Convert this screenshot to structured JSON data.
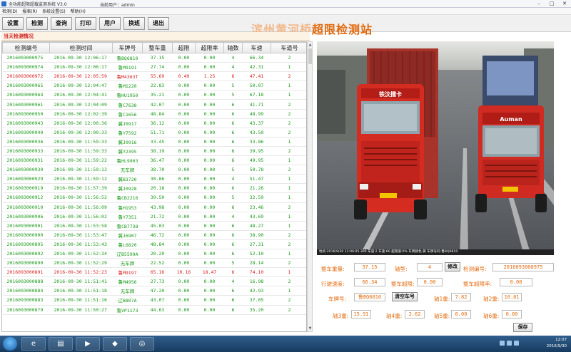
{
  "window": {
    "title": "全功能超限超载监测系统 V3.0",
    "user": "当前用户：admin"
  },
  "menu": [
    "检测(D)",
    "报表(R)",
    "系统设置(S)",
    "帮助(H)"
  ],
  "toolbar": {
    "buttons": [
      "设置",
      "检测",
      "查询",
      "打印",
      "用户",
      "换班",
      "退出"
    ]
  },
  "station": {
    "name_prefix": "滨州黄河桥",
    "name": "超限检测站"
  },
  "section": {
    "label": "当天检测情况"
  },
  "table": {
    "headers": [
      "检测编号",
      "检测时间",
      "车牌号",
      "整车重",
      "超限",
      "超限率",
      "轴数",
      "车速",
      "车道号"
    ],
    "rows": [
      {
        "id": "2016093000975",
        "time": "2016-09-30 12:06:17",
        "plate": "鲁BQ6810",
        "weight": "37.15",
        "over": "0.00",
        "rate": "0.00",
        "axles": "4",
        "speed": "66.34",
        "lane": "2",
        "status": "normal"
      },
      {
        "id": "2016093000974",
        "time": "2016-09-30 12:06:17",
        "plate": "鲁M9191",
        "weight": "27.74",
        "over": "0.00",
        "rate": "0.00",
        "axles": "4",
        "speed": "42.31",
        "lane": "1",
        "status": "normal"
      },
      {
        "id": "2016093000972",
        "time": "2016-09-30 12:05:59",
        "plate": "鲁M4363T",
        "weight": "55.69",
        "over": "0.49",
        "rate": "1.25",
        "axles": "6",
        "speed": "47.41",
        "lane": "2",
        "status": "over"
      },
      {
        "id": "2016093000965",
        "time": "2016-09-30 12:04:47",
        "plate": "鲁M1220",
        "weight": "22.83",
        "over": "0.00",
        "rate": "0.00",
        "axles": "5",
        "speed": "50.07",
        "lane": "1",
        "status": "normal"
      },
      {
        "id": "2016093000964",
        "time": "2016-09-30 12:04:41",
        "plate": "鲁HU1950",
        "weight": "35.21",
        "over": "0.00",
        "rate": "0.00",
        "axles": "5",
        "speed": "67.18",
        "lane": "1",
        "status": "normal"
      },
      {
        "id": "2016093000961",
        "time": "2016-09-30 12:04:09",
        "plate": "鲁C7638",
        "weight": "42.07",
        "over": "0.00",
        "rate": "0.00",
        "axles": "6",
        "speed": "41.71",
        "lane": "2",
        "status": "normal"
      },
      {
        "id": "2016093000950",
        "time": "2016-09-30 12:02:39",
        "plate": "鲁C1656",
        "weight": "48.84",
        "over": "0.00",
        "rate": "0.00",
        "axles": "6",
        "speed": "48.99",
        "lane": "2",
        "status": "normal"
      },
      {
        "id": "2016093000943",
        "time": "2016-09-30 12:00:36",
        "plate": "冀J0917",
        "weight": "36.12",
        "over": "0.00",
        "rate": "0.00",
        "axles": "6",
        "speed": "43.37",
        "lane": "2",
        "status": "normal"
      },
      {
        "id": "2016093000940",
        "time": "2016-09-30 12:00:33",
        "plate": "鲁Y7592",
        "weight": "51.71",
        "over": "0.00",
        "rate": "0.00",
        "axles": "6",
        "speed": "43.50",
        "lane": "2",
        "status": "normal"
      },
      {
        "id": "2016093000936",
        "time": "2016-09-30 11:59:33",
        "plate": "冀J0916",
        "weight": "33.45",
        "over": "0.00",
        "rate": "0.00",
        "axles": "6",
        "speed": "33.86",
        "lane": "1",
        "status": "normal"
      },
      {
        "id": "2016093000933",
        "time": "2016-09-30 11:59:33",
        "plate": "冀Y2395",
        "weight": "38.19",
        "over": "0.00",
        "rate": "0.00",
        "axles": "6",
        "speed": "39.95",
        "lane": "2",
        "status": "normal"
      },
      {
        "id": "2016093000931",
        "time": "2016-09-30 11:59:22",
        "plate": "鲁HL9903",
        "weight": "36.47",
        "over": "0.00",
        "rate": "0.00",
        "axles": "6",
        "speed": "49.95",
        "lane": "1",
        "status": "normal"
      },
      {
        "id": "2016093000930",
        "time": "2016-09-30 11:59:12",
        "plate": "无车牌",
        "weight": "38.70",
        "over": "0.00",
        "rate": "0.00",
        "axles": "5",
        "speed": "50.78",
        "lane": "2",
        "status": "normal"
      },
      {
        "id": "2016093000929",
        "time": "2016-09-30 11:59:12",
        "plate": "冀B3720",
        "weight": "30.86",
        "over": "0.00",
        "rate": "0.00",
        "axles": "4",
        "speed": "51.47",
        "lane": "1",
        "status": "normal"
      },
      {
        "id": "2016093000919",
        "time": "2016-09-30 11:57:39",
        "plate": "冀J0928",
        "weight": "20.18",
        "over": "0.00",
        "rate": "0.00",
        "axles": "6",
        "speed": "21.26",
        "lane": "1",
        "status": "normal"
      },
      {
        "id": "2016093000912",
        "time": "2016-09-30 11:56:52",
        "plate": "鲁CB2216",
        "weight": "39.50",
        "over": "0.00",
        "rate": "0.00",
        "axles": "5",
        "speed": "32.59",
        "lane": "1",
        "status": "normal"
      },
      {
        "id": "2016093000910",
        "time": "2016-09-30 11:56:09",
        "plate": "鲁H1953",
        "weight": "43.98",
        "over": "0.00",
        "rate": "0.00",
        "axles": "6",
        "speed": "23.46",
        "lane": "2",
        "status": "normal"
      },
      {
        "id": "2016093000906",
        "time": "2016-09-30 11:56:02",
        "plate": "鲁Y7351",
        "weight": "21.72",
        "over": "0.00",
        "rate": "0.00",
        "axles": "4",
        "speed": "43.69",
        "lane": "1",
        "status": "normal"
      },
      {
        "id": "2016093000901",
        "time": "2016-09-30 11:53:58",
        "plate": "鲁CB7738",
        "weight": "45.03",
        "over": "0.00",
        "rate": "0.00",
        "axles": "6",
        "speed": "48.27",
        "lane": "1",
        "status": "normal"
      },
      {
        "id": "2016093000900",
        "time": "2016-09-30 11:53:47",
        "plate": "冀J6907",
        "weight": "46.72",
        "over": "0.00",
        "rate": "0.00",
        "axles": "6",
        "speed": "38.90",
        "lane": "2",
        "status": "normal"
      },
      {
        "id": "2016093000895",
        "time": "2016-09-30 11:53:43",
        "plate": "鲁L6820",
        "weight": "48.84",
        "over": "0.00",
        "rate": "0.00",
        "axles": "6",
        "speed": "27.31",
        "lane": "2",
        "status": "normal"
      },
      {
        "id": "2016093000892",
        "time": "2016-09-30 11:52:34",
        "plate": "辽B5599A",
        "weight": "20.20",
        "over": "0.00",
        "rate": "0.00",
        "axles": "6",
        "speed": "52.10",
        "lane": "1",
        "status": "normal"
      },
      {
        "id": "2016093000890",
        "time": "2016-09-30 11:52:29",
        "plate": "无车牌",
        "weight": "22.52",
        "over": "0.00",
        "rate": "0.00",
        "axles": "5",
        "speed": "28.14",
        "lane": "2",
        "status": "normal"
      },
      {
        "id": "2016093000891",
        "time": "2016-09-30 11:52:23",
        "plate": "鲁M9197",
        "weight": "65.16",
        "over": "10.16",
        "rate": "18.47",
        "axles": "6",
        "speed": "74.10",
        "lane": "1",
        "status": "over"
      },
      {
        "id": "2016093000888",
        "time": "2016-09-30 11:51:41",
        "plate": "鲁M4956",
        "weight": "27.73",
        "over": "0.00",
        "rate": "0.00",
        "axles": "4",
        "speed": "16.98",
        "lane": "2",
        "status": "normal"
      },
      {
        "id": "2016093000884",
        "time": "2016-09-30 11:51:18",
        "plate": "无车牌",
        "weight": "47.20",
        "over": "0.00",
        "rate": "0.00",
        "axles": "6",
        "speed": "42.93",
        "lane": "1",
        "status": "normal"
      },
      {
        "id": "2016093000883",
        "time": "2016-09-30 11:51:16",
        "plate": "辽B807A",
        "weight": "43.07",
        "over": "0.00",
        "rate": "0.00",
        "axles": "6",
        "speed": "37.05",
        "lane": "2",
        "status": "normal"
      },
      {
        "id": "2016093000879",
        "time": "2016-09-30 11:50:27",
        "plate": "鲁VP1173",
        "weight": "44.63",
        "over": "0.00",
        "rate": "0.00",
        "axles": "6",
        "speed": "35.20",
        "lane": "2",
        "status": "normal"
      }
    ]
  },
  "photo": {
    "overlay": "地点:2016/9/30 12:06:05.300 车道:2 车速:66 超限值:0% 车牌颜色:黄 车牌号码:鲁BQ6810",
    "truck_left_text": "铁汶擂卡",
    "truck_right_text": "Auman"
  },
  "details": {
    "total_weight_label": "整车重量:",
    "total_weight": "37.15",
    "axle_count_label": "轴型:",
    "axle_count": "4",
    "modify_button": "修改",
    "detect_id_label": "检测编号:",
    "detect_id": "2016093000975",
    "speed_label": "行驶速度:",
    "speed": "66.34",
    "axle_dist_label": "整车超限:",
    "axle_dist": "0.00",
    "over_rate_label": "整车超限率:",
    "over_rate": "0.00",
    "plate_label": "车牌号:",
    "plate": "鲁BQ6810",
    "clear_plate_button": "清空车号",
    "axle1_label": "轴1重:",
    "axle1": "7.82",
    "axle2_label": "轴2重:",
    "axle2": "10.81",
    "axle3_label": "轴3重:",
    "axle3": "15.91",
    "axle4_label": "轴4重:",
    "axle4": "2.62",
    "axle5_label": "轴5重:",
    "axle5": "0.00",
    "axle6_label": "轴6重:",
    "axle6": "0.00",
    "save_button": "保存"
  },
  "taskbar": {
    "time": "12:07",
    "date": "2016/9/30",
    "apps": [
      "ie-icon",
      "folder-icon",
      "media-icon",
      "app-icon",
      "network-icon"
    ]
  }
}
